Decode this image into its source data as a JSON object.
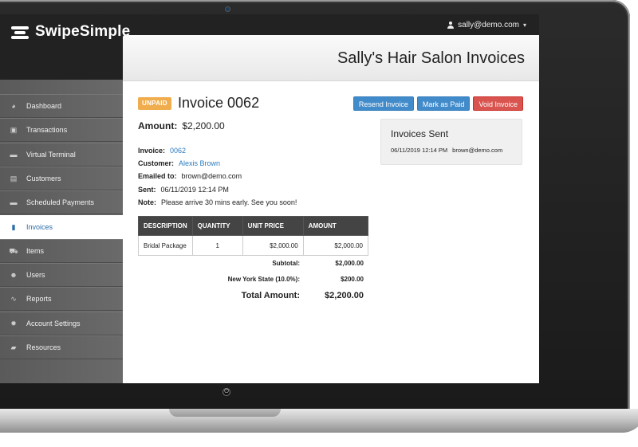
{
  "app": {
    "name": "SwipeSimple",
    "user_email": "sally@demo.com"
  },
  "sidebar": {
    "items": [
      {
        "label": "Dashboard",
        "icon": "dashboard-icon",
        "glyph": "◕",
        "active": false
      },
      {
        "label": "Transactions",
        "icon": "money-icon",
        "glyph": "▣",
        "active": false
      },
      {
        "label": "Virtual Terminal",
        "icon": "credit-card-icon",
        "glyph": "▬",
        "active": false
      },
      {
        "label": "Customers",
        "icon": "contact-card-icon",
        "glyph": "▤",
        "active": false
      },
      {
        "label": "Scheduled Payments",
        "icon": "calendar-card-icon",
        "glyph": "▬",
        "active": false
      },
      {
        "label": "Invoices",
        "icon": "document-icon",
        "glyph": "▮",
        "active": true
      },
      {
        "label": "Items",
        "icon": "cart-icon",
        "glyph": "⛟",
        "active": false
      },
      {
        "label": "Users",
        "icon": "users-icon",
        "glyph": "☻",
        "active": false
      },
      {
        "label": "Reports",
        "icon": "line-chart-icon",
        "glyph": "∿",
        "active": false
      },
      {
        "label": "Account Settings",
        "icon": "gear-icon",
        "glyph": "✹",
        "active": false
      },
      {
        "label": "Resources",
        "icon": "book-icon",
        "glyph": "▰",
        "active": false
      }
    ]
  },
  "page": {
    "title": "Sally's Hair Salon Invoices"
  },
  "invoice": {
    "status": "UNPAID",
    "title": "Invoice 0062",
    "amount_label": "Amount:",
    "amount": "$2,200.00",
    "details": {
      "invoice_label": "Invoice:",
      "invoice_value": "0062",
      "customer_label": "Customer:",
      "customer_value": "Alexis Brown",
      "emailed_label": "Emailed to:",
      "emailed_value": "brown@demo.com",
      "sent_label": "Sent:",
      "sent_value": "06/11/2019 12:14 PM",
      "note_label": "Note:",
      "note_value": "Please arrive 30 mins early. See you soon!"
    }
  },
  "actions": {
    "resend_label": "Resend Invoice",
    "mark_paid_label": "Mark as Paid",
    "void_label": "Void Invoice"
  },
  "sent_panel": {
    "title": "Invoices Sent",
    "date": "06/11/2019 12:14 PM",
    "email": "brown@demo.com"
  },
  "line_items": {
    "headers": [
      "DESCRIPTION",
      "QUANTITY",
      "UNIT PRICE",
      "AMOUNT"
    ],
    "rows": [
      {
        "description": "Bridal Package",
        "quantity": "1",
        "unit_price": "$2,000.00",
        "amount": "$2,000.00"
      }
    ]
  },
  "totals": {
    "subtotal_label": "Subtotal:",
    "subtotal_value": "$2,000.00",
    "tax_label": "New York State (10.0%):",
    "tax_value": "$200.00",
    "total_label": "Total Amount:",
    "total_value": "$2,200.00"
  },
  "colors": {
    "accent": "#428bca",
    "danger": "#d9534f",
    "warning": "#f0ad4e",
    "link": "#2b7bbf"
  }
}
